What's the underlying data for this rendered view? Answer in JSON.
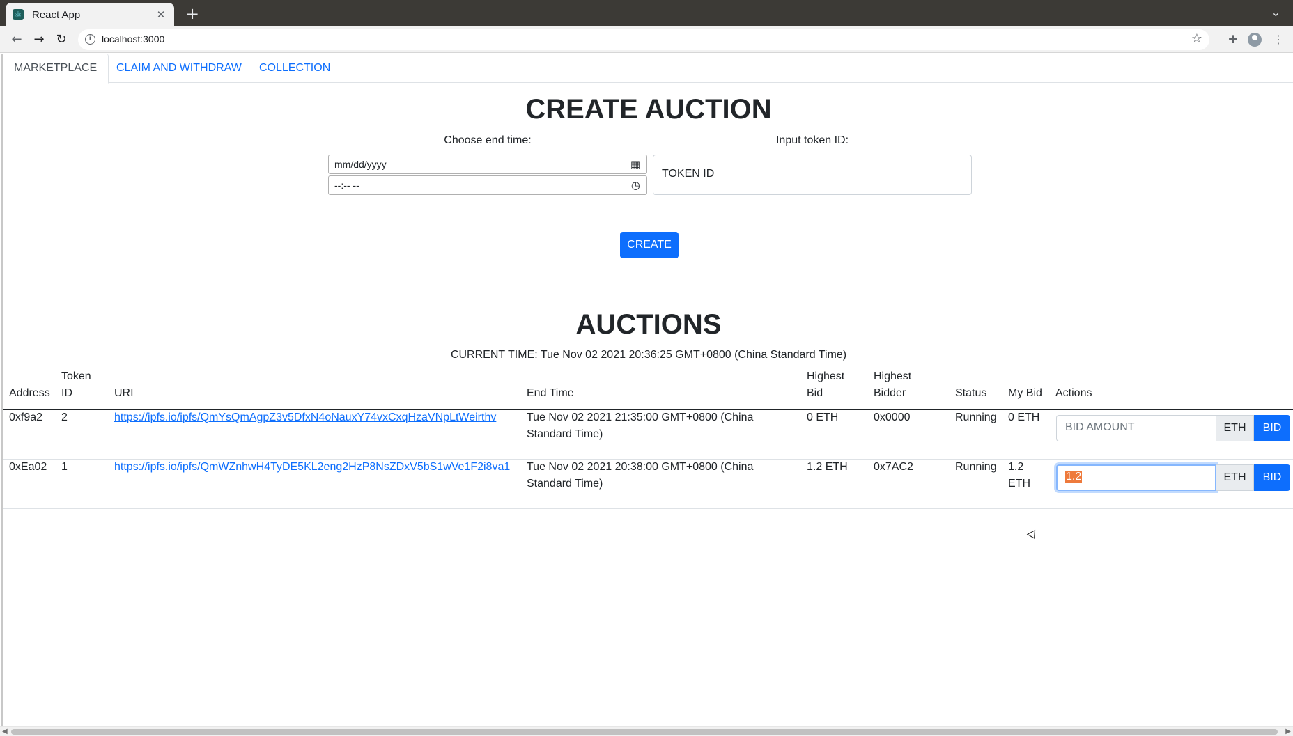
{
  "browser": {
    "tab_title": "React App",
    "tab_close": "✕",
    "new_tab": "+",
    "tab_search": "⌄",
    "url": "localhost:3000",
    "icons": {
      "back": "back-arrow-icon",
      "forward": "forward-arrow-icon",
      "reload": "reload-icon",
      "info": "info-icon",
      "star": "star-icon",
      "extensions": "puzzle-icon",
      "profile": "profile-icon",
      "menu": "kebab-menu-icon"
    }
  },
  "nav": {
    "tabs": [
      {
        "label": "MARKETPLACE",
        "active": true
      },
      {
        "label": "CLAIM AND WITHDRAW",
        "active": false
      },
      {
        "label": "COLLECTION",
        "active": false
      }
    ]
  },
  "create_auction": {
    "title": "CREATE AUCTION",
    "end_time_label": "Choose end time:",
    "date_placeholder": "mm/dd/yyyy",
    "time_placeholder": "--:-- --",
    "token_label": "Input token ID:",
    "token_placeholder": "TOKEN ID",
    "create_button": "CREATE"
  },
  "auctions": {
    "title": "AUCTIONS",
    "current_time": "CURRENT TIME: Tue Nov 02 2021 20:36:25 GMT+0800 (China Standard Time)",
    "columns": [
      "Address",
      "Token ID",
      "URI",
      "End Time",
      "Highest Bid",
      "Highest Bidder",
      "Status",
      "My Bid",
      "Actions"
    ],
    "columns_display": {
      "address": "Address",
      "token_id_1": "Token",
      "token_id_2": "ID",
      "uri": "URI",
      "end_time": "End Time",
      "highest_bid_1": "Highest",
      "highest_bid_2": "Bid",
      "highest_bidder_1": "Highest",
      "highest_bidder_2": "Bidder",
      "status": "Status",
      "my_bid": "My Bid",
      "actions": "Actions"
    },
    "rows": [
      {
        "address": "0xf9a2",
        "token_id": "2",
        "uri": "https://ipfs.io/ipfs/QmYsQmAgpZ3v5DfxN4oNauxY74vxCxqHzaVNpLtWeirthv",
        "end_time_1": "Tue Nov 02 2021 21:35:00 GMT+0800 (China",
        "end_time_2": "Standard Time)",
        "highest_bid": "0 ETH",
        "highest_bidder": "0x0000",
        "status": "Running",
        "my_bid_1": "0 ETH",
        "my_bid_2": "",
        "bid_placeholder": "BID AMOUNT",
        "bid_value": "",
        "unit": "ETH",
        "bid_button": "BID"
      },
      {
        "address": "0xEa02",
        "token_id": "1",
        "uri": "https://ipfs.io/ipfs/QmWZnhwH4TyDE5KL2eng2HzP8NsZDxV5bS1wVe1F2i8va1",
        "end_time_1": "Tue Nov 02 2021 20:38:00 GMT+0800 (China",
        "end_time_2": "Standard Time)",
        "highest_bid": "1.2 ETH",
        "highest_bidder": "0x7AC2",
        "status": "Running",
        "my_bid_1": "1.2",
        "my_bid_2": "ETH",
        "bid_placeholder": "BID AMOUNT",
        "bid_value": "1.2",
        "unit": "ETH",
        "bid_button": "BID"
      }
    ]
  },
  "colors": {
    "primary": "#0d6efd",
    "text": "#212529",
    "selection": "#ee7a3c"
  }
}
